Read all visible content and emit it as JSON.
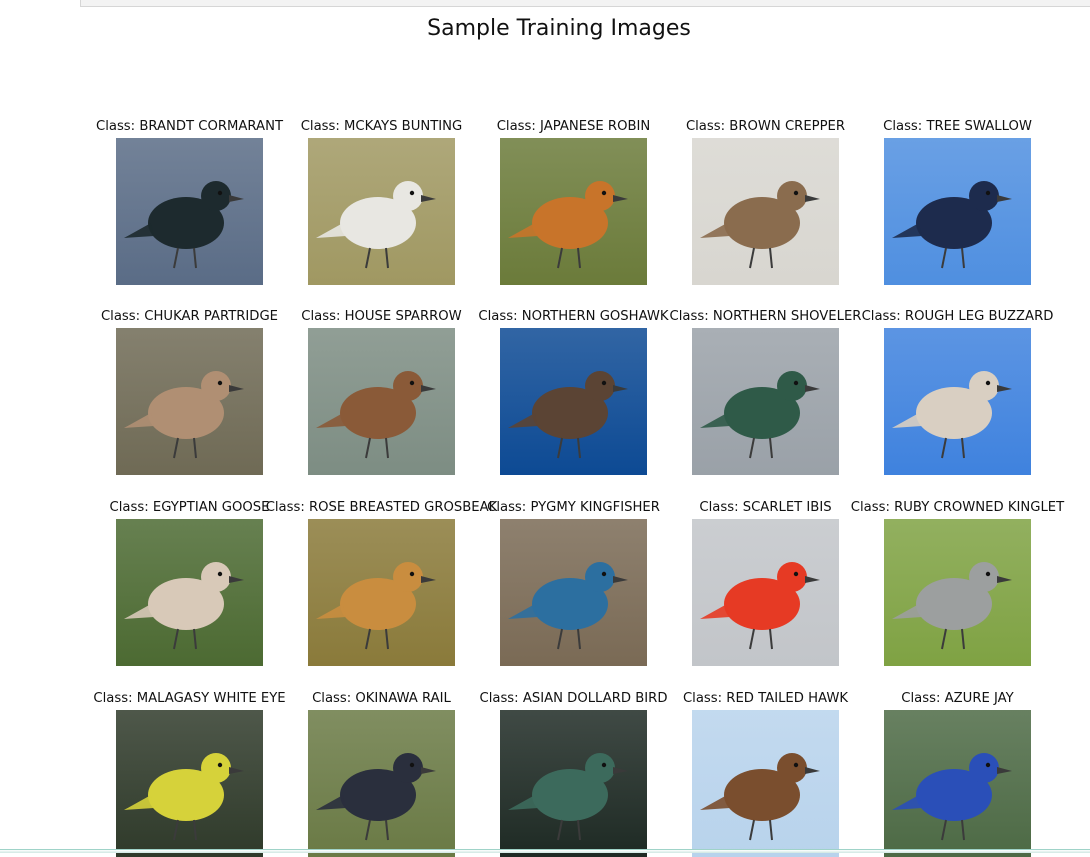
{
  "figure": {
    "title": "Sample Training Images",
    "images": [
      {
        "label": "Class: BRANDT CORMARANT",
        "icon": "cormorant-image",
        "bg": "#5a6c86",
        "bird": "#1d2a2e"
      },
      {
        "label": "Class: MCKAYS BUNTING",
        "icon": "bunting-image",
        "bg": "#a09862",
        "bird": "#e8e7e2"
      },
      {
        "label": "Class: JAPANESE ROBIN",
        "icon": "robin-image",
        "bg": "#6b7b3a",
        "bird": "#c8742a"
      },
      {
        "label": "Class: BROWN CREPPER",
        "icon": "creeper-image",
        "bg": "#d8d6d0",
        "bird": "#8a6c4e"
      },
      {
        "label": "Class: TREE SWALLOW",
        "icon": "swallow-image",
        "bg": "#4f8fe0",
        "bird": "#1d2b4d"
      },
      {
        "label": "Class: CHUKAR PARTRIDGE",
        "icon": "partridge-image",
        "bg": "#6f6a55",
        "bird": "#b08f73"
      },
      {
        "label": "Class: HOUSE SPARROW",
        "icon": "sparrow-image",
        "bg": "#7d8d83",
        "bird": "#8a5a38"
      },
      {
        "label": "Class: NORTHERN GOSHAWK",
        "icon": "goshawk-image",
        "bg": "#0d4a94",
        "bird": "#5b4434"
      },
      {
        "label": "Class: NORTHERN SHOVELER",
        "icon": "shoveler-image",
        "bg": "#9aa1a8",
        "bird": "#2f5a48"
      },
      {
        "label": "Class: ROUGH LEG BUZZARD",
        "icon": "buzzard-image",
        "bg": "#3f82de",
        "bird": "#d9cfc2"
      },
      {
        "label": "Class: EGYPTIAN GOOSE",
        "icon": "goose-image",
        "bg": "#4c6a32",
        "bird": "#d8c9b8"
      },
      {
        "label": "Class: ROSE BREASTED GROSBEAK",
        "icon": "grosbeak-image",
        "bg": "#8a7a3a",
        "bird": "#c98d3f"
      },
      {
        "label": "Class: PYGMY KINGFISHER",
        "icon": "kingfisher-image",
        "bg": "#7a6a55",
        "bird": "#2c6fa0"
      },
      {
        "label": "Class: SCARLET IBIS",
        "icon": "ibis-image",
        "bg": "#c2c5c9",
        "bird": "#e63a24"
      },
      {
        "label": "Class: RUBY CROWNED KINGLET",
        "icon": "kinglet-image",
        "bg": "#7fa243",
        "bird": "#9c9f9f"
      },
      {
        "label": "Class: MALAGASY WHITE EYE",
        "icon": "white-eye-image",
        "bg": "#2f3a2a",
        "bird": "#d6d23a"
      },
      {
        "label": "Class: OKINAWA RAIL",
        "icon": "rail-image",
        "bg": "#6a7a45",
        "bird": "#2a2f3d"
      },
      {
        "label": "Class: ASIAN DOLLARD BIRD",
        "icon": "dollarbird-image",
        "bg": "#1e2a24",
        "bird": "#3c6a5c"
      },
      {
        "label": "Class: RED TAILED HAWK",
        "icon": "hawk-image",
        "bg": "#b8d3ec",
        "bird": "#7a4e2e"
      },
      {
        "label": "Class: AZURE JAY",
        "icon": "jay-image",
        "bg": "#4d6a45",
        "bird": "#2a4fb8"
      }
    ]
  }
}
